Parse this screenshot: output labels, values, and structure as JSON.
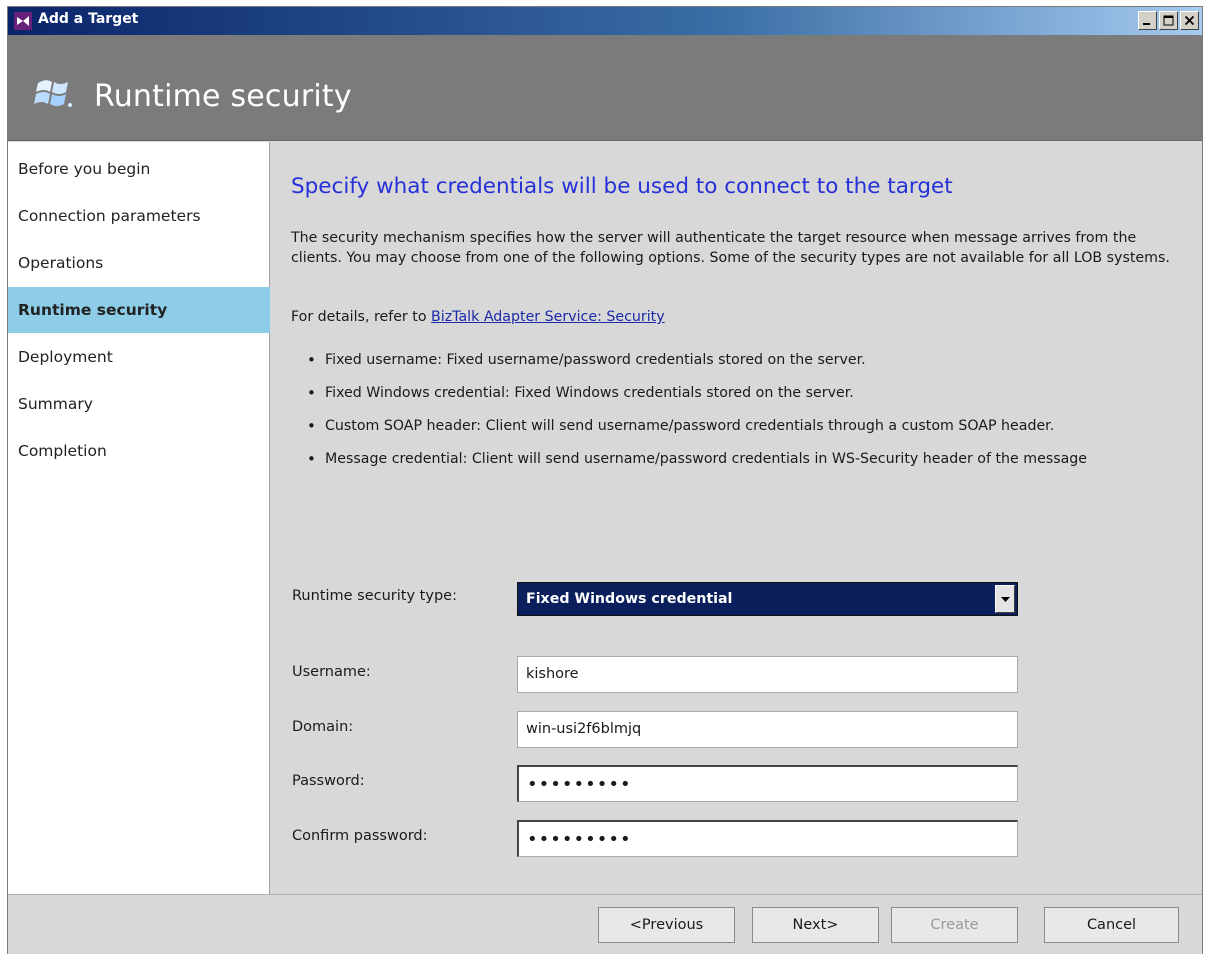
{
  "window": {
    "title": "Add a Target"
  },
  "header": {
    "title": "Runtime security"
  },
  "nav": {
    "items": [
      {
        "label": "Before you begin"
      },
      {
        "label": "Connection parameters"
      },
      {
        "label": "Operations"
      },
      {
        "label": "Runtime security",
        "active": true
      },
      {
        "label": "Deployment"
      },
      {
        "label": "Summary"
      },
      {
        "label": "Completion"
      }
    ]
  },
  "main": {
    "heading": "Specify what credentials will be used to connect to the target",
    "description": "The security mechanism specifies how the server will authenticate the target resource when message arrives from the clients. You may choose from one of the following options. Some of the security types are not available for all LOB systems.",
    "details_prefix": "For details, refer to ",
    "details_link": "BizTalk Adapter Service: Security",
    "bullets": [
      "Fixed username: Fixed username/password credentials stored on the server.",
      "Fixed Windows credential: Fixed Windows credentials stored on the server.",
      "Custom SOAP header: Client will send username/password credentials through a custom SOAP header.",
      "Message credential: Client will send username/password credentials in WS-Security header of the message"
    ]
  },
  "form": {
    "security_type_label": "Runtime security type:",
    "security_type_value": "Fixed Windows credential",
    "username_label": "Username:",
    "username_value": "kishore",
    "domain_label": "Domain:",
    "domain_value": "win-usi2f6blmjq",
    "password_label": "Password:",
    "password_value": "•••••••••",
    "confirm_label": "Confirm password:",
    "confirm_value": "•••••••••"
  },
  "footer": {
    "previous": "<Previous",
    "next": "Next>",
    "create": "Create",
    "cancel": "Cancel"
  },
  "colors": {
    "heading": "#2530d8",
    "nav_active": "#8dcde8",
    "header_band": "#7b7b7b",
    "select_bg": "#0a1f5c"
  }
}
